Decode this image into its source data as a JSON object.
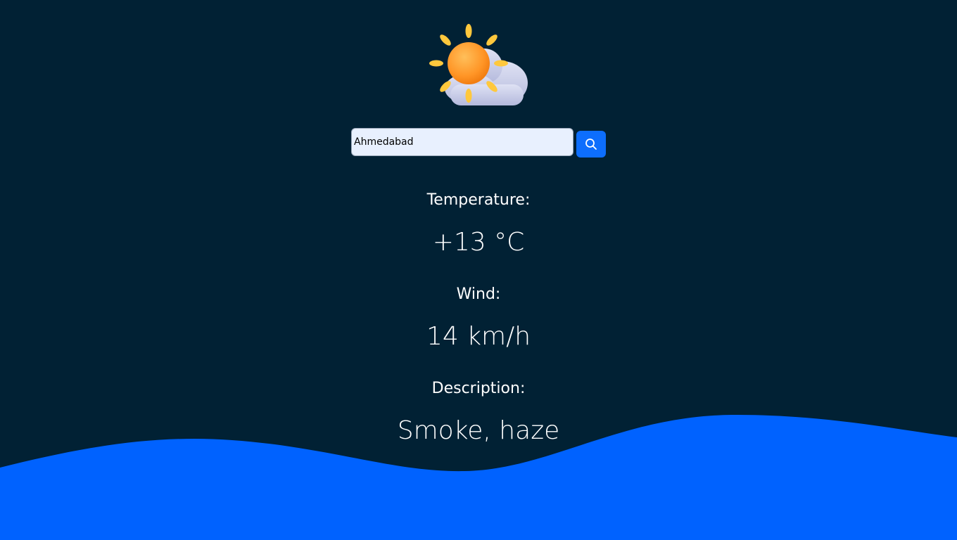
{
  "search": {
    "value": "Ahmedabad",
    "placeholder": "",
    "button_icon": "search-icon"
  },
  "weather_icon": "sun-behind-cloud-icon",
  "temperature": {
    "label": "Temperature:",
    "value": "+13 °C"
  },
  "wind": {
    "label": "Wind:",
    "value": "14 km/h"
  },
  "description": {
    "label": "Description:",
    "value": "Smoke, haze"
  },
  "colors": {
    "background": "#012134",
    "wave": "#0062ff",
    "button": "#0d6efd",
    "input_background": "#e8f0fe",
    "sun": "#ff9d2e",
    "sun_rays": "#ffc83d",
    "cloud": "#c9cde8"
  }
}
